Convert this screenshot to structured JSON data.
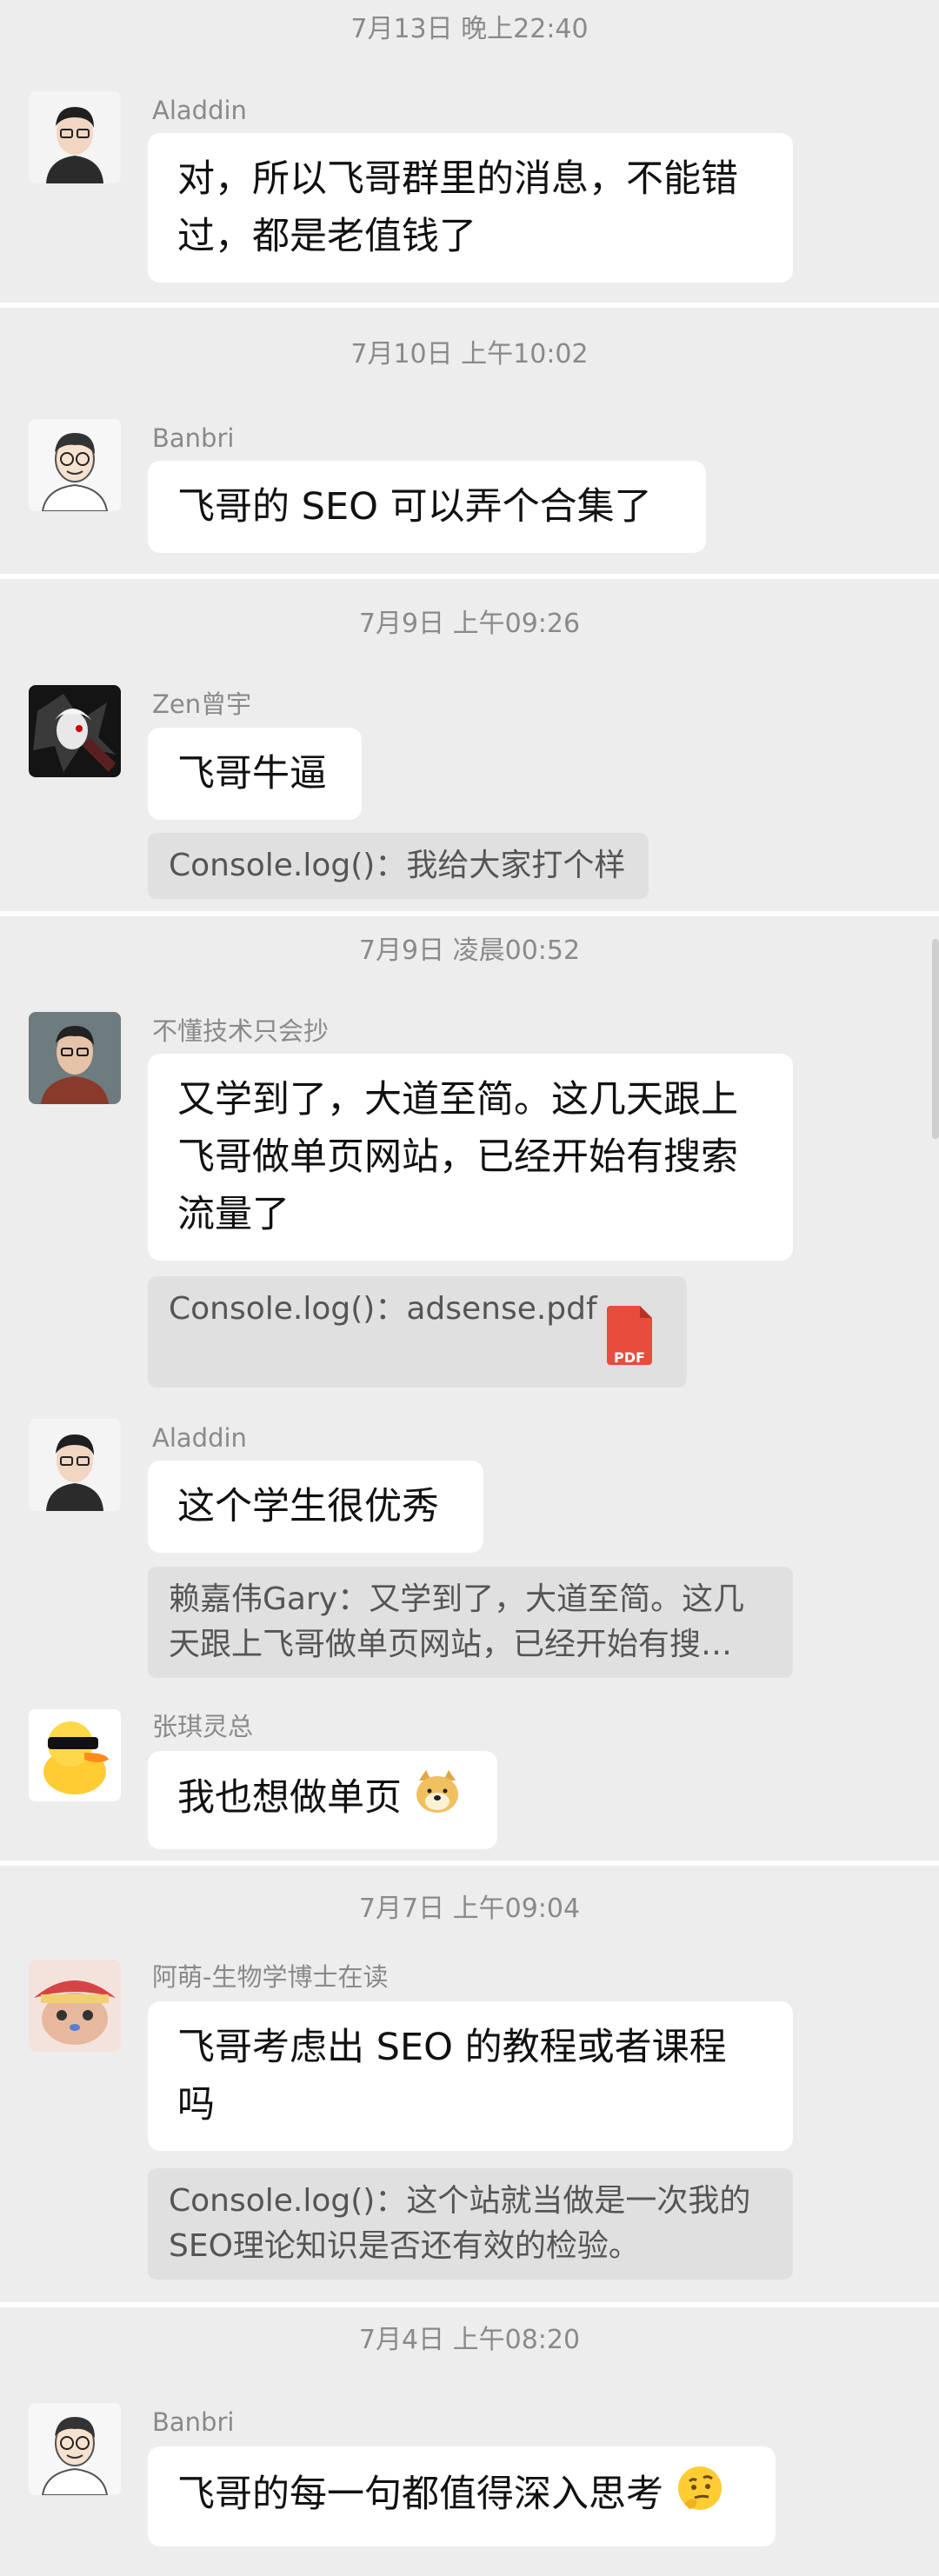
{
  "sections": [
    {
      "timestamp": "7月13日 晚上22:40",
      "messages": [
        {
          "sender": "Aladdin",
          "text_lines": [
            "对，所以飞哥群里的消息，不能错",
            "过，都是老值钱了"
          ]
        }
      ]
    },
    {
      "timestamp": "7月10日 上午10:02",
      "messages": [
        {
          "sender": "Banbri",
          "text_lines": [
            "飞哥的 SEO 可以弄个合集了"
          ]
        }
      ]
    },
    {
      "timestamp": "7月9日 上午09:26",
      "messages": [
        {
          "sender": "Zen曾宇",
          "text_lines": [
            "飞哥牛逼"
          ],
          "quote": "Console.log()：我给大家打个样"
        }
      ]
    },
    {
      "timestamp": "7月9日 凌晨00:52",
      "messages": [
        {
          "sender": "不懂技术只会抄",
          "text_lines": [
            "又学到了，大道至简。这几天跟上",
            "飞哥做单页网站，已经开始有搜索",
            "流量了"
          ],
          "quote": "Console.log()：adsense.pdf",
          "quote_file_badge": "PDF"
        },
        {
          "sender": "Aladdin",
          "text_lines": [
            "这个学生很优秀"
          ],
          "quote_lines": [
            "赖嘉伟Gary：又学到了，大道至简。这几",
            "天跟上飞哥做单页网站，已经开始有搜…"
          ]
        },
        {
          "sender": "张琪灵总",
          "text_lines": [
            "我也想做单页"
          ],
          "emoji": "doge-emoji"
        }
      ]
    },
    {
      "timestamp": "7月7日 上午09:04",
      "messages": [
        {
          "sender": "阿萌-生物学博士在读",
          "text_lines": [
            "飞哥考虑出 SEO 的教程或者课程",
            "吗"
          ],
          "quote_lines": [
            "Console.log()：这个站就当做是一次我的",
            "SEO理论知识是否还有效的检验。"
          ]
        }
      ]
    },
    {
      "timestamp": "7月4日 上午08:20",
      "messages": [
        {
          "sender": "Banbri",
          "text_lines": [
            "飞哥的每一句都值得深入思考"
          ],
          "emoji": "thinking-face-emoji"
        }
      ]
    }
  ]
}
